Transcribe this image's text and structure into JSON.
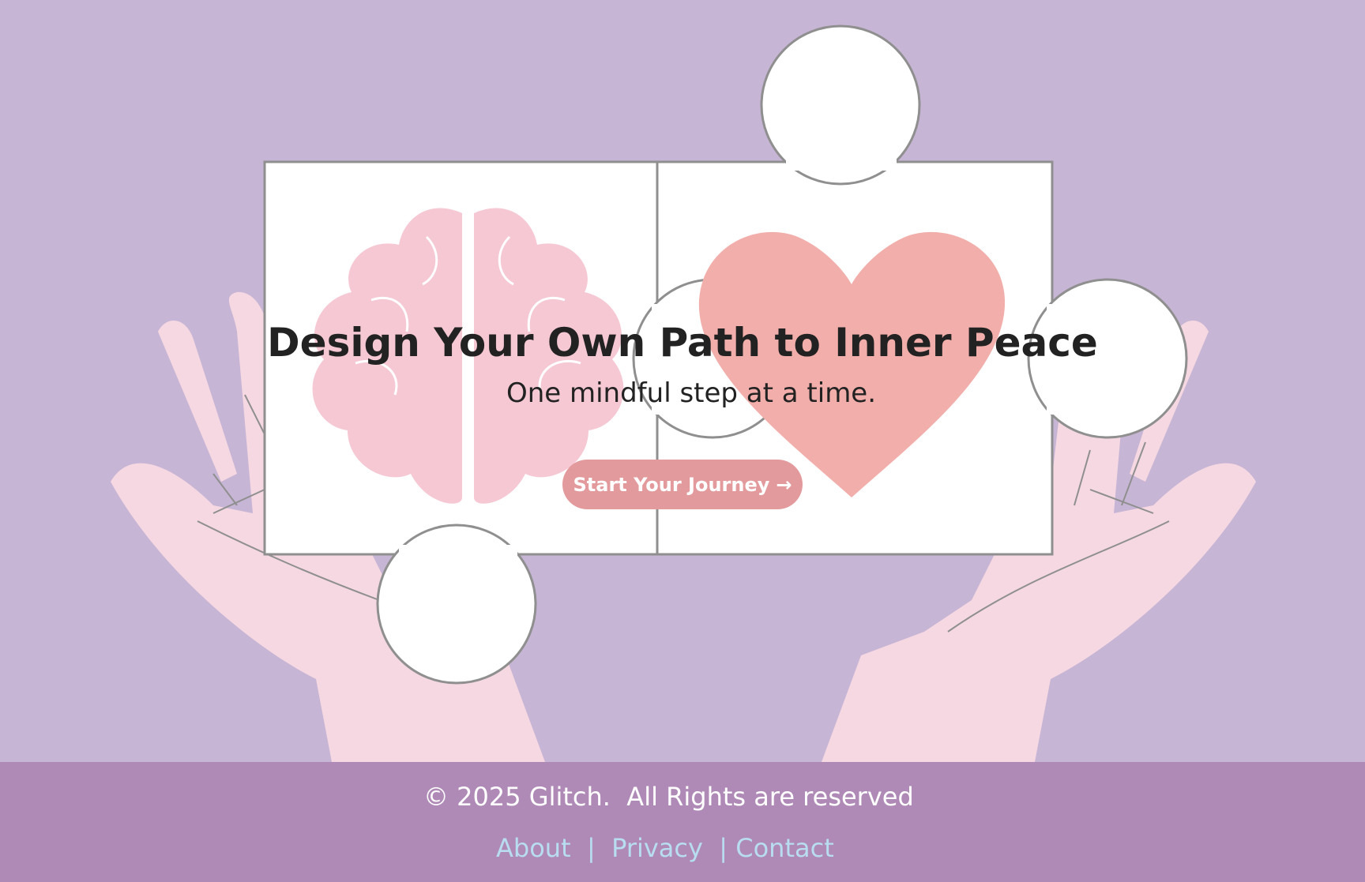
{
  "hero": {
    "title": "Design Your Own Path to Inner Peace",
    "subtitle": "One mindful step at a time.",
    "cta_label": "Start Your Journey",
    "cta_arrow": "→",
    "background_color": "#c5b1d3",
    "illustration_icon": "hands-holding-puzzle-brain-heart"
  },
  "footer": {
    "copyright": "© 2025 Glitch.  All Rights are reserved",
    "links": [
      {
        "label": "About"
      },
      {
        "label": "Privacy"
      },
      {
        "label": "Contact"
      }
    ],
    "separator": "|",
    "background_color": "#b08ab7",
    "link_color": "#b8ddf0"
  },
  "colors": {
    "button": "#e39a9c",
    "brain": "#f5c6d2",
    "heart": "#f2aaa6",
    "hands": "#f5d6e0"
  }
}
